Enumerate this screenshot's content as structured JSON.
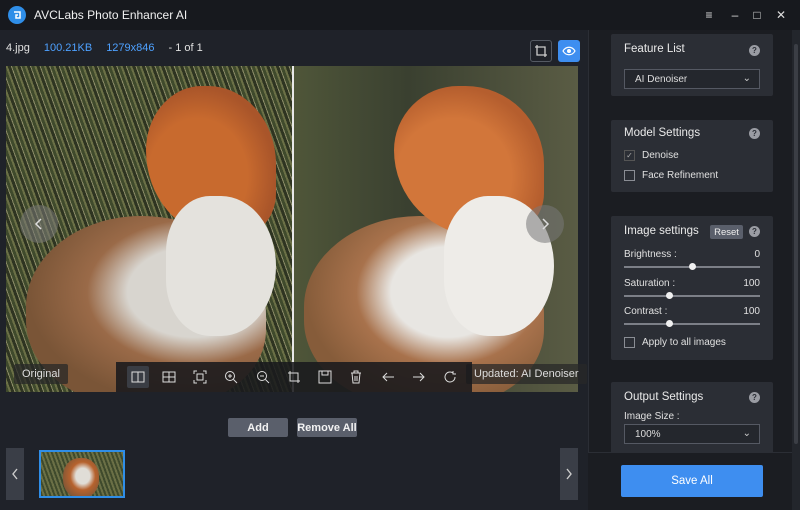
{
  "window": {
    "title": "AVCLabs Photo Enhancer AI",
    "controls": [
      "≡",
      "–",
      "□",
      "✕"
    ]
  },
  "info": {
    "filename": "4.jpg",
    "filesize": "100.21KB",
    "dimensions": "1279x846",
    "page": "- 1 of 1"
  },
  "preview": {
    "left_label": "Original",
    "right_label": "Updated: AI Denoiser"
  },
  "toolbar": {
    "icons": [
      "compare-split-icon",
      "grid-view-icon",
      "fit-screen-icon",
      "zoom-in-icon",
      "zoom-out-icon",
      "crop-icon",
      "save-icon",
      "delete-icon",
      "arrow-left-icon",
      "arrow-right-icon",
      "rotate-icon"
    ]
  },
  "buttons": {
    "add": "Add",
    "remove_all": "Remove All",
    "save_all": "Save All"
  },
  "feature_list": {
    "title": "Feature List",
    "selected": "AI Denoiser"
  },
  "model_settings": {
    "title": "Model Settings",
    "denoise": "Denoise",
    "face_refinement": "Face Refinement"
  },
  "image_settings": {
    "title": "Image settings",
    "reset": "Reset",
    "brightness": {
      "label": "Brightness :",
      "value": "0",
      "level": 0.5
    },
    "saturation": {
      "label": "Saturation :",
      "value": "100",
      "level": 0.33
    },
    "contrast": {
      "label": "Contrast :",
      "value": "100",
      "level": 0.33
    },
    "apply_all": "Apply to all images"
  },
  "output_settings": {
    "title": "Output Settings",
    "image_size_label": "Image Size :",
    "image_size": "100%"
  },
  "help_glyph": "?",
  "colors": {
    "accent": "#3e8ef0",
    "background": "#1f2229",
    "panel": "#2b2e35"
  }
}
